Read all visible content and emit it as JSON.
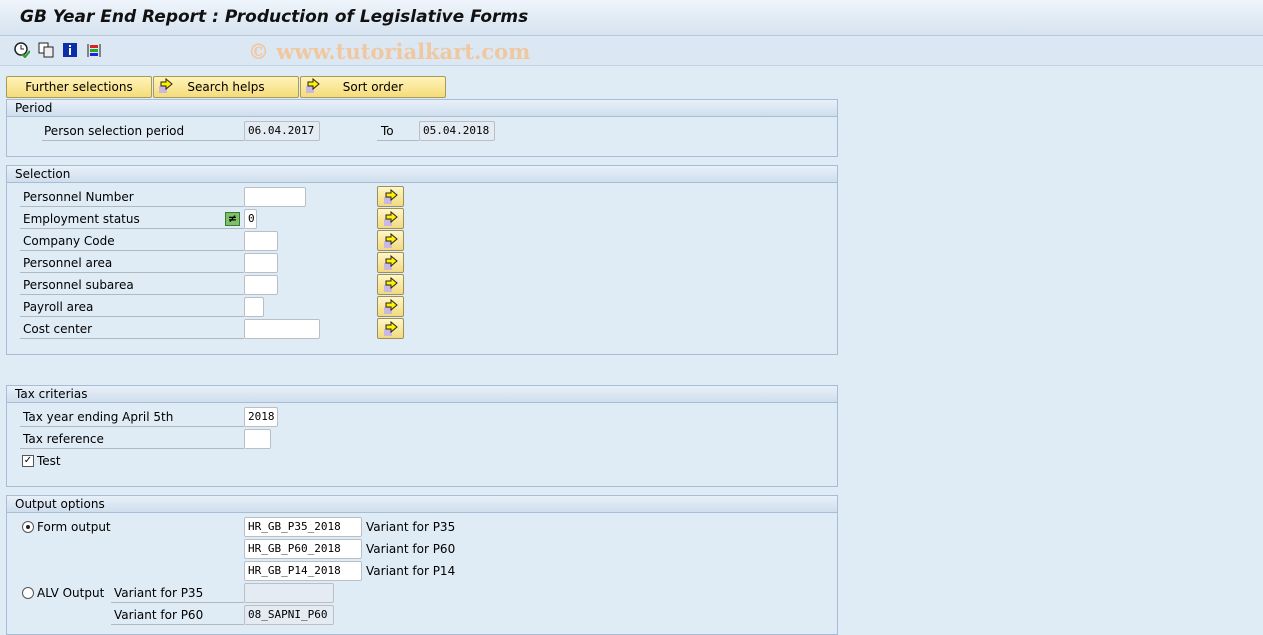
{
  "title": "GB Year End Report : Production of Legislative Forms",
  "watermark": "© www.tutorialkart.com",
  "toolbar": {
    "icons": [
      "execute-clock-icon",
      "copy-variant-icon",
      "info-icon",
      "selection-options-icon"
    ]
  },
  "buttons": {
    "further": "Further selections",
    "search": "Search helps",
    "sort": "Sort order"
  },
  "period": {
    "header": "Period",
    "label": "Person selection period",
    "from": "06.04.2017",
    "to_label": "To",
    "to": "05.04.2018"
  },
  "selection": {
    "header": "Selection",
    "rows": [
      {
        "label": "Personnel Number",
        "value": ""
      },
      {
        "label": "Employment status",
        "value": "0"
      },
      {
        "label": "Company Code",
        "value": ""
      },
      {
        "label": "Personnel area",
        "value": ""
      },
      {
        "label": "Personnel subarea",
        "value": ""
      },
      {
        "label": "Payroll area",
        "value": ""
      },
      {
        "label": "Cost center",
        "value": ""
      }
    ]
  },
  "tax": {
    "header": "Tax criterias",
    "year_label": "Tax year ending April 5th",
    "year": "2018",
    "ref_label": "Tax reference",
    "ref": "",
    "test_label": "Test",
    "test_checked": true
  },
  "output": {
    "header": "Output options",
    "form_label": "Form output",
    "form_selected": true,
    "form_variants": [
      {
        "value": "HR_GB_P35_2018",
        "label": "Variant for P35"
      },
      {
        "value": "HR_GB_P60_2018",
        "label": "Variant for P60"
      },
      {
        "value": "HR_GB_P14_2018",
        "label": "Variant for P14"
      }
    ],
    "alv_label": "ALV Output",
    "alv_variants": [
      {
        "label": "Variant for P35",
        "value": ""
      },
      {
        "label": "Variant for P60",
        "value": "08_SAPNI_P60"
      }
    ]
  }
}
